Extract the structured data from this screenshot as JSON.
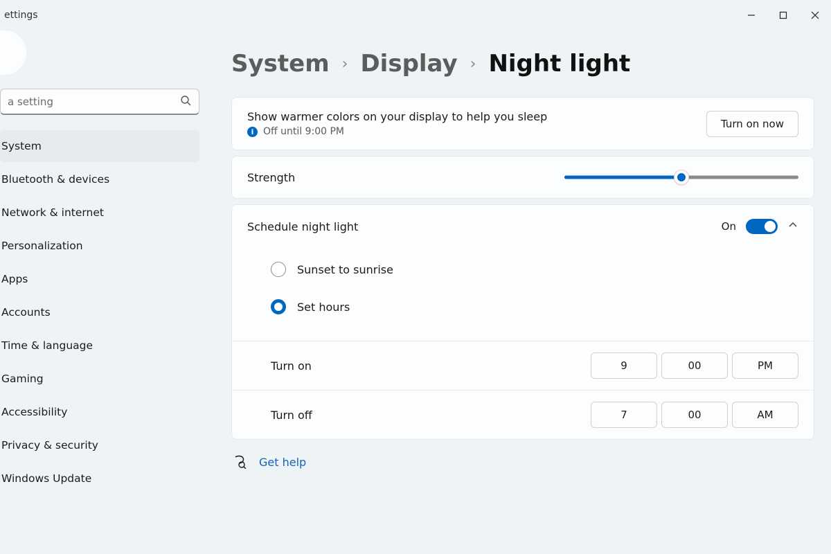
{
  "app": {
    "title": "ettings"
  },
  "search": {
    "placeholder": "a setting"
  },
  "sidebar": {
    "items": [
      {
        "label": "System",
        "selected": true
      },
      {
        "label": "Bluetooth & devices"
      },
      {
        "label": "Network & internet"
      },
      {
        "label": "Personalization"
      },
      {
        "label": "Apps"
      },
      {
        "label": "Accounts"
      },
      {
        "label": "Time & language"
      },
      {
        "label": "Gaming"
      },
      {
        "label": "Accessibility"
      },
      {
        "label": "Privacy & security"
      },
      {
        "label": "Windows Update"
      }
    ]
  },
  "breadcrumb": {
    "a": "System",
    "b": "Display",
    "c": "Night light"
  },
  "header": {
    "desc": "Show warmer colors on your display to help you sleep",
    "status": "Off until 9:00 PM",
    "button": "Turn on now"
  },
  "strength": {
    "label": "Strength",
    "percent": 50
  },
  "schedule": {
    "label": "Schedule night light",
    "state": "On",
    "options": {
      "sunset": "Sunset to sunrise",
      "sethours": "Set hours"
    },
    "turn_on": {
      "label": "Turn on",
      "h": "9",
      "m": "00",
      "ap": "PM"
    },
    "turn_off": {
      "label": "Turn off",
      "h": "7",
      "m": "00",
      "ap": "AM"
    }
  },
  "help": {
    "label": "Get help"
  }
}
